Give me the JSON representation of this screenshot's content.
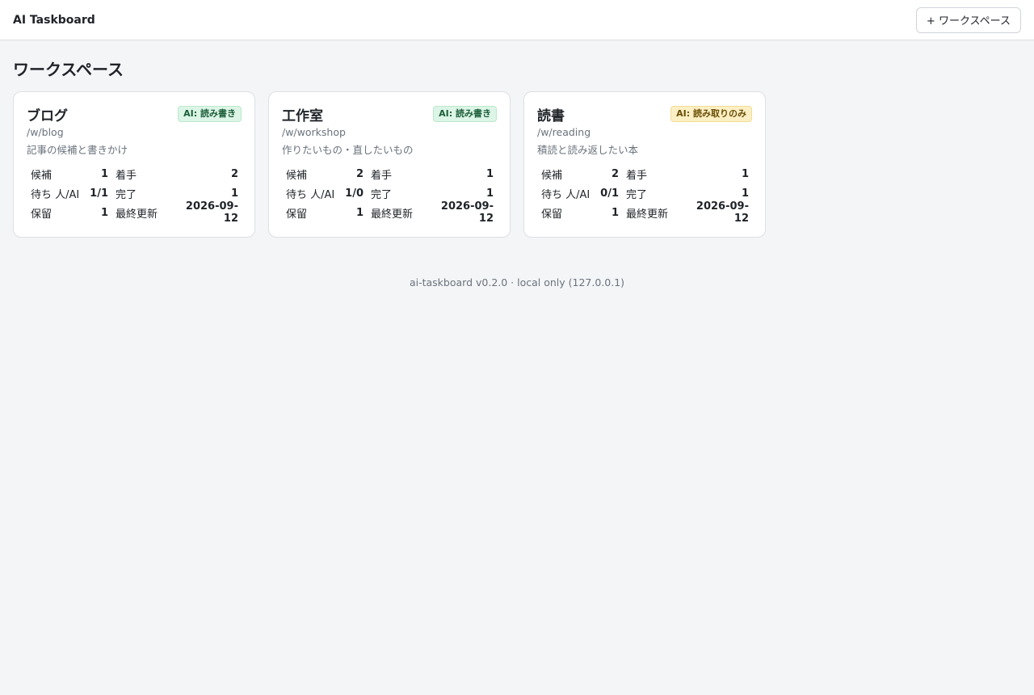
{
  "header": {
    "app_title": "AI Taskboard",
    "new_workspace_label": "+ ワークスペース"
  },
  "main": {
    "title": "ワークスペース",
    "workspaces": [
      {
        "name": "ブログ",
        "badge": "AI: 読み書き",
        "badge_kind": "read-write",
        "path": "/w/blog",
        "description": "記事の候補と書きかけ",
        "stats": {
          "candidate_label": "候補",
          "candidate": "1",
          "started_label": "着手",
          "started": "2",
          "waiting_label": "待ち 人/AI",
          "waiting": "1/1",
          "done_label": "完了",
          "done": "1",
          "hold_label": "保留",
          "hold": "1",
          "updated_label": "最終更新",
          "updated": "2026-09-12"
        }
      },
      {
        "name": "工作室",
        "badge": "AI: 読み書き",
        "badge_kind": "read-write",
        "path": "/w/workshop",
        "description": "作りたいもの・直したいもの",
        "stats": {
          "candidate_label": "候補",
          "candidate": "2",
          "started_label": "着手",
          "started": "1",
          "waiting_label": "待ち 人/AI",
          "waiting": "1/0",
          "done_label": "完了",
          "done": "1",
          "hold_label": "保留",
          "hold": "1",
          "updated_label": "最終更新",
          "updated": "2026-09-12"
        }
      },
      {
        "name": "読書",
        "badge": "AI: 読み取りのみ",
        "badge_kind": "read-only",
        "path": "/w/reading",
        "description": "積読と読み返したい本",
        "stats": {
          "candidate_label": "候補",
          "candidate": "2",
          "started_label": "着手",
          "started": "1",
          "waiting_label": "待ち 人/AI",
          "waiting": "0/1",
          "done_label": "完了",
          "done": "1",
          "hold_label": "保留",
          "hold": "1",
          "updated_label": "最終更新",
          "updated": "2026-09-12"
        }
      }
    ]
  },
  "footer": {
    "text": "ai-taskboard v0.2.0 · local only (127.0.0.1)"
  },
  "colors": {
    "badge_read_write_bg": "#dcf5e6",
    "badge_read_only_bg": "#fcefc4",
    "page_bg": "#f4f5f7"
  }
}
